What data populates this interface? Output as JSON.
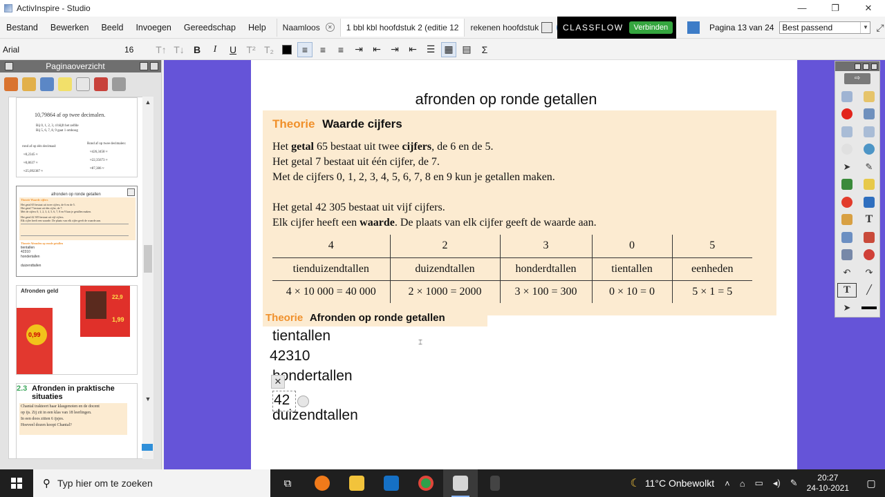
{
  "window": {
    "title": "ActivInspire - Studio",
    "controls": [
      "—",
      "❐",
      "✕"
    ]
  },
  "menu": [
    "Bestand",
    "Bewerken",
    "Beeld",
    "Invoegen",
    "Gereedschap",
    "Help"
  ],
  "doc_tabs": [
    {
      "label": "Naamloos",
      "active": false
    },
    {
      "label": "1 bbl kbl hoofdstuk 2 (editie 12",
      "active": true
    },
    {
      "label": "rekenen hoofdstuk",
      "active": false
    }
  ],
  "classflow": {
    "logo": "CLASSFLOW",
    "button": "Verbinden"
  },
  "pagination": {
    "label": "Pagina 13 van 24",
    "zoom": "Best passend"
  },
  "format": {
    "font": "Arial",
    "size": "16",
    "buttons": [
      "T↑",
      "T↓",
      "B",
      "I",
      "U",
      "T²",
      "T₂",
      "■",
      "≡",
      "≡",
      "≡",
      "⇥",
      "⇤",
      "⇥",
      "⇤",
      "☰",
      "▦",
      "▤",
      "Σ"
    ]
  },
  "left_panel": {
    "title": "Paginaoverzicht",
    "thumbs": [
      {
        "title": "10,79864 af op twee decimalen.",
        "lines": [
          "Bij 0, 1, 2, 3, 4 blijft het zelfde",
          "Bij 5, 6, 7, 8, 9 gaat 1 omhoog"
        ],
        "col1_head": "rond af op één decimaal:",
        "col1": [
          "≈0,2345 ≈",
          "≈0,8637 ≈",
          "≈25,092387 ≈"
        ],
        "col2_head": "Rond af op twee decimalen:",
        "col2": [
          "≈426,3458 ≈",
          "≈22,35673 ≈",
          "≈87,386 ≈"
        ]
      },
      {
        "title": "afronden op ronde getallen",
        "sub_head": "Theorie  Waarde cijfers",
        "lines": [
          "Het getal 65 bestaat uit twee cijfers, de 6 en de 5.",
          "Het getal 7 bestaat uit één cijfer, de 7.",
          "Met de cijfers 0, 1, 2, 3, 4, 5, 6, 7, 8 en 9 kun je getallen maken.",
          "Het getal 42 305 bestaat uit vijf cijfers.",
          "Elk cijfer heeft een waarde. De plaats van elk cijfer geeft de waarde aan."
        ],
        "sub_head2": "Theorie  Afronden op ronde getallen",
        "hand": [
          "tientallen",
          "42310",
          "hondertallen",
          "",
          "duizendtallen"
        ]
      },
      {
        "title": "Afronden geld",
        "prices": [
          "0,99",
          "22,9",
          "1,99"
        ]
      },
      {
        "title_num": "2.3",
        "title": "Afronden in praktische situaties",
        "lines": [
          "Chantal trakteert haar klasgenoten en de docent",
          "op ijs. Zij zit in een klas van 18 leerlingen.",
          "In een doos zitten 6 ijsjes.",
          "Hoeveel dozen koopt Chantal?"
        ]
      }
    ]
  },
  "page": {
    "title": "afronden op ronde getallen",
    "theorie_label": "Theorie",
    "theorie_title": "Waarde cijfers",
    "p1": {
      "a": "Het ",
      "b": "getal",
      "c": " 65 bestaat uit twee ",
      "d": "cijfers",
      "e": ", de 6 en de 5."
    },
    "p2": "Het getal 7 bestaat uit één cijfer, de 7.",
    "p3": "Met de cijfers 0, 1, 2, 3, 4, 5, 6, 7, 8 en 9 kun je getallen maken.",
    "p4": "Het getal 42 305 bestaat uit vijf cijfers.",
    "p5": {
      "a": "Elk cijfer heeft een ",
      "b": "waarde",
      "c": ". De plaats van elk cijfer geeft de waarde aan."
    },
    "table": {
      "digits": [
        "4",
        "2",
        "3",
        "0",
        "5"
      ],
      "names": [
        "tienduizendtallen",
        "duizendtallen",
        "honderdtallen",
        "tientallen",
        "eenheden"
      ],
      "calcs": [
        "4 × 10 000 = 40 000",
        "2 × 1000 = 2000",
        "3 × 100 = 300",
        "0 × 10 = 0",
        "5 × 1 = 5"
      ]
    },
    "theorie2_label": "Theorie",
    "theorie2_title": "Afronden op ronde getallen",
    "handwritten": {
      "l1": "tientallen",
      "l2": "42310",
      "l3": "hondertallen",
      "l4": "42",
      "l5": "duizendtallen"
    }
  },
  "taskbar": {
    "search_placeholder": "Typ hier om te zoeken",
    "weather": "11°C  Onbewolkt",
    "time": "20:27",
    "date": "24-10-2021"
  }
}
